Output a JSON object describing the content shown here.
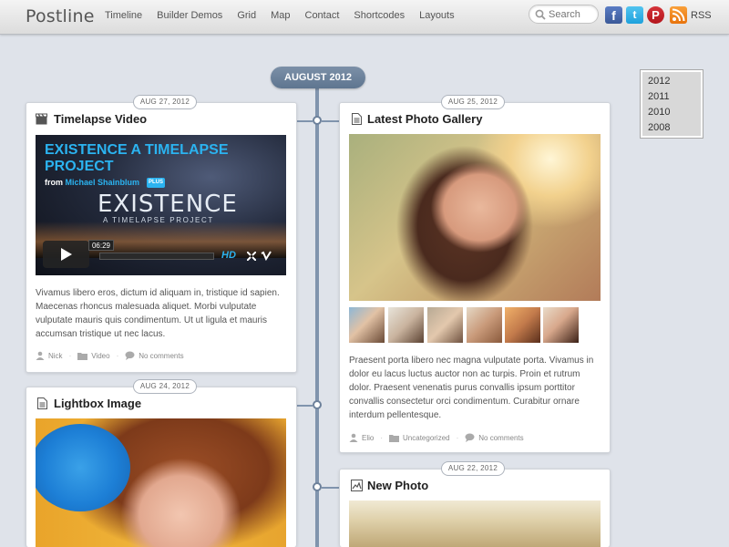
{
  "site": {
    "logo": "Postline",
    "nav": [
      "Timeline",
      "Builder Demos",
      "Grid",
      "Map",
      "Contact",
      "Shortcodes",
      "Layouts"
    ],
    "search_placeholder": "Search",
    "social": {
      "facebook": "f",
      "twitter": "t",
      "pinterest": "P",
      "rss_label": "RSS"
    }
  },
  "timeline": {
    "month": "AUGUST 2012",
    "years": [
      "2012",
      "2011",
      "2010",
      "2008"
    ]
  },
  "posts": [
    {
      "date": "AUG 27, 2012",
      "title": "Timelapse Video",
      "icon": "clapperboard-icon",
      "video": {
        "title": "EXISTENCE A TIMELAPSE PROJECT",
        "from": "from",
        "author": "Michael Shainblum",
        "badge": "PLUS",
        "big_word": "EXISTENCE",
        "small_word": "A TIMELAPSE PROJECT",
        "time": "06:29",
        "hd": "HD"
      },
      "excerpt": "Vivamus libero eros, dictum id aliquam in, tristique id sapien. Maecenas rhoncus malesuada aliquet. Morbi vulputate vulputate mauris quis condimentum. Ut ut ligula et mauris accumsan tristique ut nec lacus.",
      "author": "Nick",
      "category": "Video",
      "comments": "No comments"
    },
    {
      "date": "AUG 25, 2012",
      "title": "Latest Photo Gallery",
      "icon": "document-icon",
      "excerpt": "Praesent porta libero nec magna vulputate porta. Vivamus in dolor eu lacus luctus auctor non ac turpis. Proin et rutrum dolor. Praesent venenatis purus convallis ipsum porttitor convallis consectetur orci condimentum. Curabitur ornare interdum pellentesque.",
      "author": "Elio",
      "category": "Uncategorized",
      "comments": "No comments"
    },
    {
      "date": "AUG 24, 2012",
      "title": "Lightbox Image",
      "icon": "document-icon"
    },
    {
      "date": "AUG 22, 2012",
      "title": "New Photo",
      "icon": "image-icon"
    }
  ],
  "colors": {
    "background": "#dfe3ea",
    "timeline": "#8094ad",
    "accent_blue": "#2bb3f0"
  }
}
